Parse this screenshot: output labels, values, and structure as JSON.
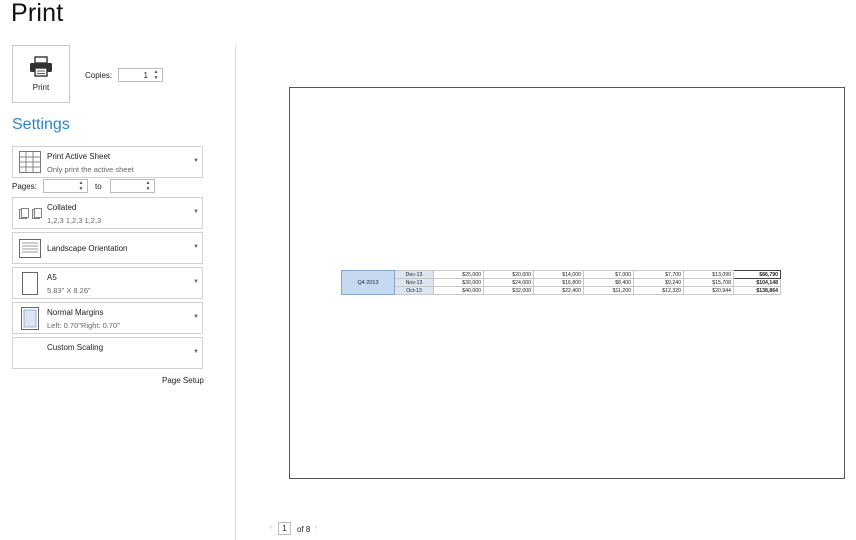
{
  "header": {
    "title": "Print"
  },
  "print_button": {
    "label": "Print",
    "icon": "printer-icon"
  },
  "copies": {
    "label": "Copies:",
    "value": "1"
  },
  "settings": {
    "heading": "Settings",
    "print_what": {
      "title": "Print Active Sheet",
      "subtitle": "Only print the active sheet",
      "icon": "sheet-grid-icon"
    },
    "pages": {
      "label": "Pages:",
      "to_label": "to",
      "from_value": "",
      "to_value": ""
    },
    "collation": {
      "title": "Collated",
      "subtitle": "1,2,3   1,2,3   1,2,3",
      "icon": "collated-icon"
    },
    "orientation": {
      "title": "Landscape Orientation",
      "icon": "landscape-icon"
    },
    "paper_size": {
      "title": "A5",
      "subtitle": "5.83\" X 8.26\"",
      "icon": "paper-size-icon"
    },
    "margins": {
      "title": "Normal Margins",
      "subtitle": "Left: 0.70\"Right: 0.70\"",
      "icon": "margins-icon"
    },
    "scaling": {
      "title": "Custom Scaling"
    },
    "page_setup_link": "Page Setup"
  },
  "preview": {
    "sheet": {
      "quarter": "Q4 2013",
      "rows": [
        {
          "month": "Dec-13",
          "values": [
            "$25,000",
            "$20,000",
            "$14,000",
            "$7,000",
            "$7,700",
            "$13,090"
          ],
          "total": "$86,790"
        },
        {
          "month": "Nov-13",
          "values": [
            "$30,000",
            "$24,000",
            "$16,800",
            "$8,400",
            "$9,240",
            "$15,708"
          ],
          "total": "$104,148"
        },
        {
          "month": "Oct-13",
          "values": [
            "$40,000",
            "$32,000",
            "$22,400",
            "$11,200",
            "$12,320",
            "$20,944"
          ],
          "total": "$138,864"
        }
      ]
    }
  },
  "pager": {
    "current": "1",
    "of_text": "of 8"
  },
  "colors": {
    "accent": "#2b88c8",
    "quarter_cell": "#c5d9f1",
    "month_cell": "#dce6f1"
  }
}
